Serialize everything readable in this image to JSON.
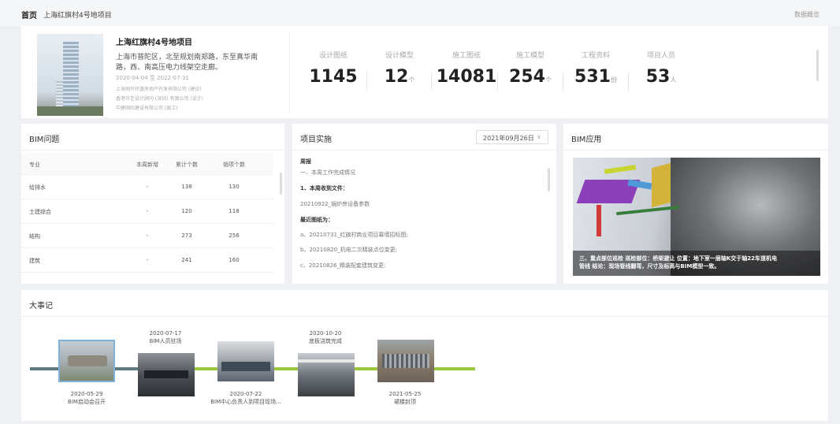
{
  "breadcrumb": {
    "home": "首页",
    "project": "上海红旗村4号地项目",
    "overview_link": "数据概览"
  },
  "project": {
    "name": "上海红旗村4号地项目",
    "address_line1": "上海市普陀区，北至规划南郑路，东至真华南",
    "address_line2": "路，西、南高压电力线架空走廊。",
    "date_start": "2020-04-04",
    "date_sep": "至",
    "date_end": "2022-07-31",
    "org1": "上海翔开环盛房地产开发有限公司 (建设)",
    "org2": "香港华艺设计顾问 (深圳) 有限公司 (设计)",
    "org3": "中建国际建设有限公司 (施工)"
  },
  "stats": [
    {
      "label": "设计图纸",
      "value": "1145",
      "unit": ""
    },
    {
      "label": "设计模型",
      "value": "12",
      "unit": "个"
    },
    {
      "label": "施工图纸",
      "value": "14081",
      "unit": ""
    },
    {
      "label": "施工模型",
      "value": "254",
      "unit": "个"
    },
    {
      "label": "工程资料",
      "value": "531",
      "unit": "份"
    },
    {
      "label": "项目人员",
      "value": "53",
      "unit": "人"
    }
  ],
  "bim_issues": {
    "title": "BIM问题",
    "columns": [
      "专业",
      "本周新增",
      "累计个数",
      "销项个数"
    ],
    "rows": [
      [
        "给排水",
        "-",
        "138",
        "130"
      ],
      [
        "土建综合",
        "-",
        "120",
        "118"
      ],
      [
        "结构",
        "-",
        "273",
        "256"
      ],
      [
        "建筑",
        "-",
        "241",
        "160"
      ]
    ]
  },
  "implementation": {
    "title": "项目实施",
    "date": "2021年09月26日",
    "lines": [
      "周报",
      "一、本周工作完成情况",
      "1、本周收到文件：",
      "20210922_锅炉房设备参数",
      "最近图纸为：",
      "a、20210731_红旗村商业项目幕墙招标图;",
      "b、20210820_机电二次精装点位变更;",
      "c、20210826_精装配套建筑变更;"
    ]
  },
  "bim_app": {
    "title": "BIM应用",
    "caption_line1": "三、重点部位巡检 巡检部位：桥架避让 位置：地下室一层轴K交于轴22车道机电",
    "caption_line2": "管线 结论：现场管线翻弯，尺寸及标高与BIM模型一致。"
  },
  "milestones": {
    "title": "大事记",
    "events": [
      {
        "date": "2020-05-29",
        "text": "BIM启动会召开"
      },
      {
        "date": "2020-07-17",
        "text": "BIM人员驻场"
      },
      {
        "date": "2020-07-22",
        "text": "BIM中心负责人到项目现场..."
      },
      {
        "date": "2020-10-20",
        "text": "底板浇筑完成"
      },
      {
        "date": "2021-05-25",
        "text": "裙楼封顶"
      }
    ]
  },
  "colors": {
    "timeline_dark": "#5f7a80",
    "timeline_green": "#9bc53d",
    "selected_border": "#7fb0d8"
  }
}
